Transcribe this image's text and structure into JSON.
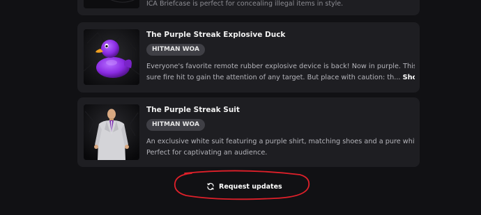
{
  "items": [
    {
      "title": "",
      "description": "ICA Briefcase is perfect for concealing illegal items in style."
    },
    {
      "title": "The Purple Streak Explosive Duck",
      "badge": "HITMAN WOA",
      "description_line1": "Everyone's favorite remote rubber explosive device is back! Now in purple. This is a",
      "description_line2": "sure fire hit to gain the attention of any target. But place with caution: th...",
      "show_more_label": "Show more"
    },
    {
      "title": "The Purple Streak Suit",
      "badge": "HITMAN WOA",
      "description_line1": "An exclusive white suit featuring a purple shirt, matching shoes and a pure white tie.",
      "description_line2": "Perfect for captivating an audience."
    }
  ],
  "request_button": {
    "label": "Request updates",
    "icon": "refresh-icon"
  },
  "colors": {
    "background": "#111114",
    "card": "#1e1e22",
    "badge": "#3f3f45",
    "annotation": "#e0202a",
    "duck": "#8a2be2"
  }
}
